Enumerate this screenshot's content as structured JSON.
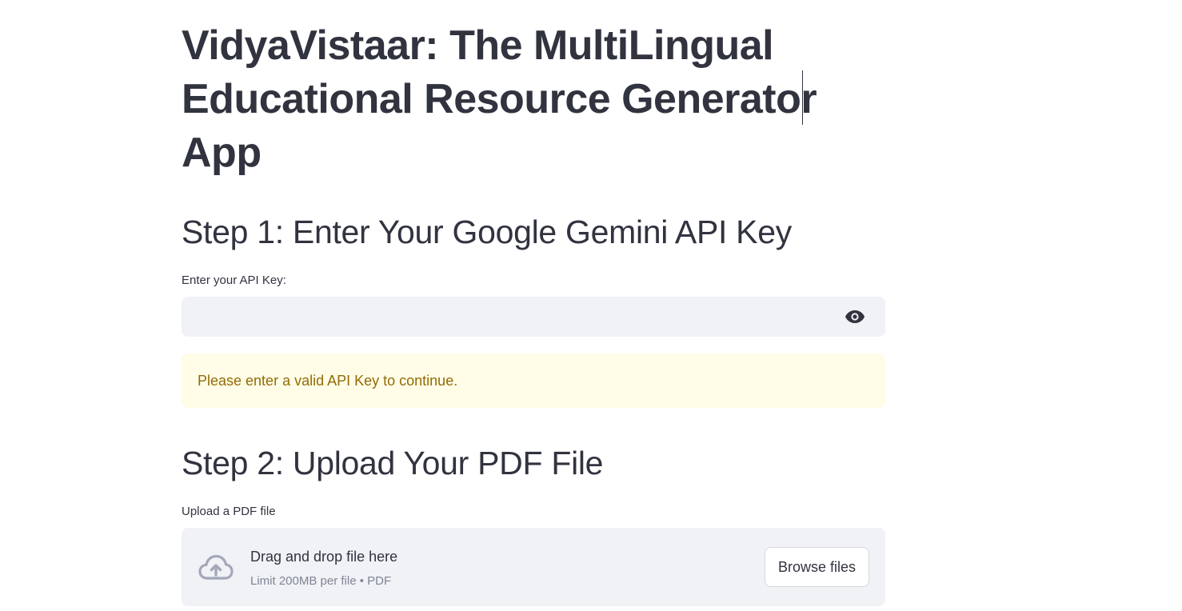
{
  "app": {
    "title": "VidyaVistaar: The MultiLingual Educational Resource Generator App"
  },
  "step1": {
    "heading": "Step 1: Enter Your Google Gemini API Key",
    "input_label": "Enter your API Key:",
    "input_value": "",
    "input_type": "password",
    "toggle_icon": "eye-icon",
    "warning": "Please enter a valid API Key to continue."
  },
  "step2": {
    "heading": "Step 2: Upload Your PDF File",
    "uploader_label": "Upload a PDF file",
    "drop_title": "Drag and drop file here",
    "drop_limit": "Limit 200MB per file • PDF",
    "upload_icon": "cloud-upload-icon",
    "browse_label": "Browse files"
  },
  "colors": {
    "text": "#31333f",
    "input_bg": "#f0f2f6",
    "warning_bg": "#fffce7",
    "warning_text": "#926c05",
    "muted_text": "#808495"
  }
}
